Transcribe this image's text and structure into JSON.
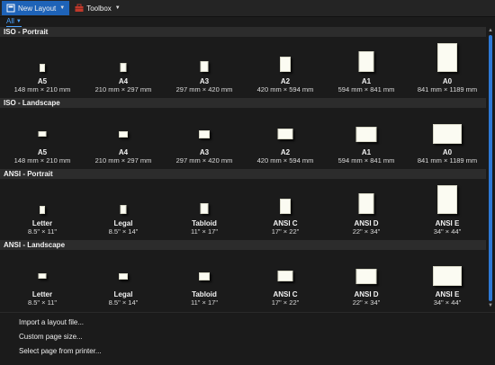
{
  "toolbar": {
    "tabs": [
      {
        "label": "New Layout",
        "icon": "layout-icon"
      },
      {
        "label": "Toolbox",
        "icon": "toolbox-icon"
      }
    ]
  },
  "filter": {
    "label": "All"
  },
  "sections": [
    {
      "title": "ISO - Portrait",
      "items": [
        {
          "name": "A5",
          "dims": "148 mm × 210 mm"
        },
        {
          "name": "A4",
          "dims": "210 mm × 297 mm"
        },
        {
          "name": "A3",
          "dims": "297 mm × 420 mm"
        },
        {
          "name": "A2",
          "dims": "420 mm × 594 mm"
        },
        {
          "name": "A1",
          "dims": "594 mm  × 841 mm"
        },
        {
          "name": "A0",
          "dims": "841 mm × 1189 mm"
        }
      ]
    },
    {
      "title": "ISO - Landscape",
      "items": [
        {
          "name": "A5",
          "dims": "148 mm × 210 mm"
        },
        {
          "name": "A4",
          "dims": "210 mm × 297 mm"
        },
        {
          "name": "A3",
          "dims": "297 mm × 420 mm"
        },
        {
          "name": "A2",
          "dims": "420 mm × 594 mm"
        },
        {
          "name": "A1",
          "dims": "594 mm  × 841 mm"
        },
        {
          "name": "A0",
          "dims": "841 mm × 1189 mm"
        }
      ]
    },
    {
      "title": "ANSI - Portrait",
      "items": [
        {
          "name": "Letter",
          "dims": "8.5\" × 11\""
        },
        {
          "name": "Legal",
          "dims": "8.5\" × 14\""
        },
        {
          "name": "Tabloid",
          "dims": "11\" × 17\""
        },
        {
          "name": "ANSI C",
          "dims": "17\" × 22\""
        },
        {
          "name": "ANSI D",
          "dims": "22\" × 34\""
        },
        {
          "name": "ANSI E",
          "dims": "34\" × 44\""
        }
      ]
    },
    {
      "title": "ANSI - Landscape",
      "items": [
        {
          "name": "Letter",
          "dims": "8.5\" × 11\""
        },
        {
          "name": "Legal",
          "dims": "8.5\" × 14\""
        },
        {
          "name": "Tabloid",
          "dims": "11\" × 17\""
        },
        {
          "name": "ANSI C",
          "dims": "17\" × 22\""
        },
        {
          "name": "ANSI D",
          "dims": "22\" × 34\""
        },
        {
          "name": "ANSI E",
          "dims": "34\" × 44\""
        }
      ]
    }
  ],
  "footer": {
    "links": [
      "Import a layout file...",
      "Custom page size...",
      "Select page from printer..."
    ]
  },
  "colors": {
    "accent": "#1e63b8",
    "link": "#4aa3ff",
    "background": "#1b1b1b",
    "header": "#2c2c2c",
    "page": "#fbfbf2"
  }
}
